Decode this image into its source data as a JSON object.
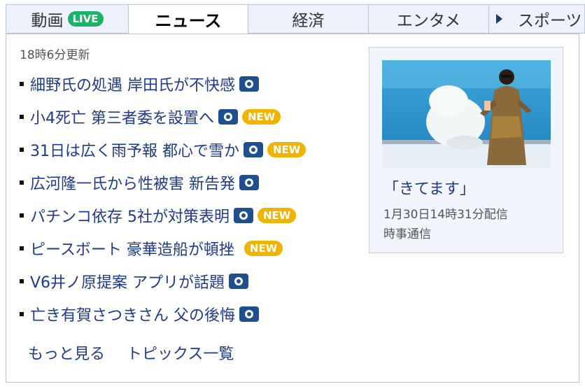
{
  "tabs": [
    {
      "label": "動画",
      "badge": "LIVE"
    },
    {
      "label": "ニュース"
    },
    {
      "label": "経済"
    },
    {
      "label": "エンタメ"
    },
    {
      "label": "スポーツ"
    }
  ],
  "updated_text": "18時6分更新",
  "news": [
    {
      "title": "細野氏の処遇 岸田氏が不快感",
      "camera": true,
      "new_badge": ""
    },
    {
      "title": "小4死亡 第三者委を設置へ",
      "camera": true,
      "new_badge": "NEW"
    },
    {
      "title": "31日は広く雨予報 都心で雪か",
      "camera": true,
      "new_badge": "NEW"
    },
    {
      "title": "広河隆一氏から性被害 新告発",
      "camera": true,
      "new_badge": ""
    },
    {
      "title": "パチンコ依存 5社が対策表明",
      "camera": true,
      "new_badge": "NEW"
    },
    {
      "title": "ピースボート 豪華造船が頓挫",
      "camera": false,
      "new_badge": "NEW"
    },
    {
      "title": "V6井ノ原提案 アプリが話題",
      "camera": true,
      "new_badge": ""
    },
    {
      "title": "亡き有賀さつきさん 父の後悔",
      "camera": true,
      "new_badge": ""
    }
  ],
  "more_links": {
    "more": "もっと見る",
    "topics": "トピックス一覧"
  },
  "feature": {
    "title": "「きてます」",
    "date": "1月30日14時31分配信",
    "source": "時事通信"
  },
  "colors": {
    "link": "#1f3a8a",
    "live": "#1bb36a",
    "new": "#f0b400",
    "camera": "#1f4f8f"
  }
}
